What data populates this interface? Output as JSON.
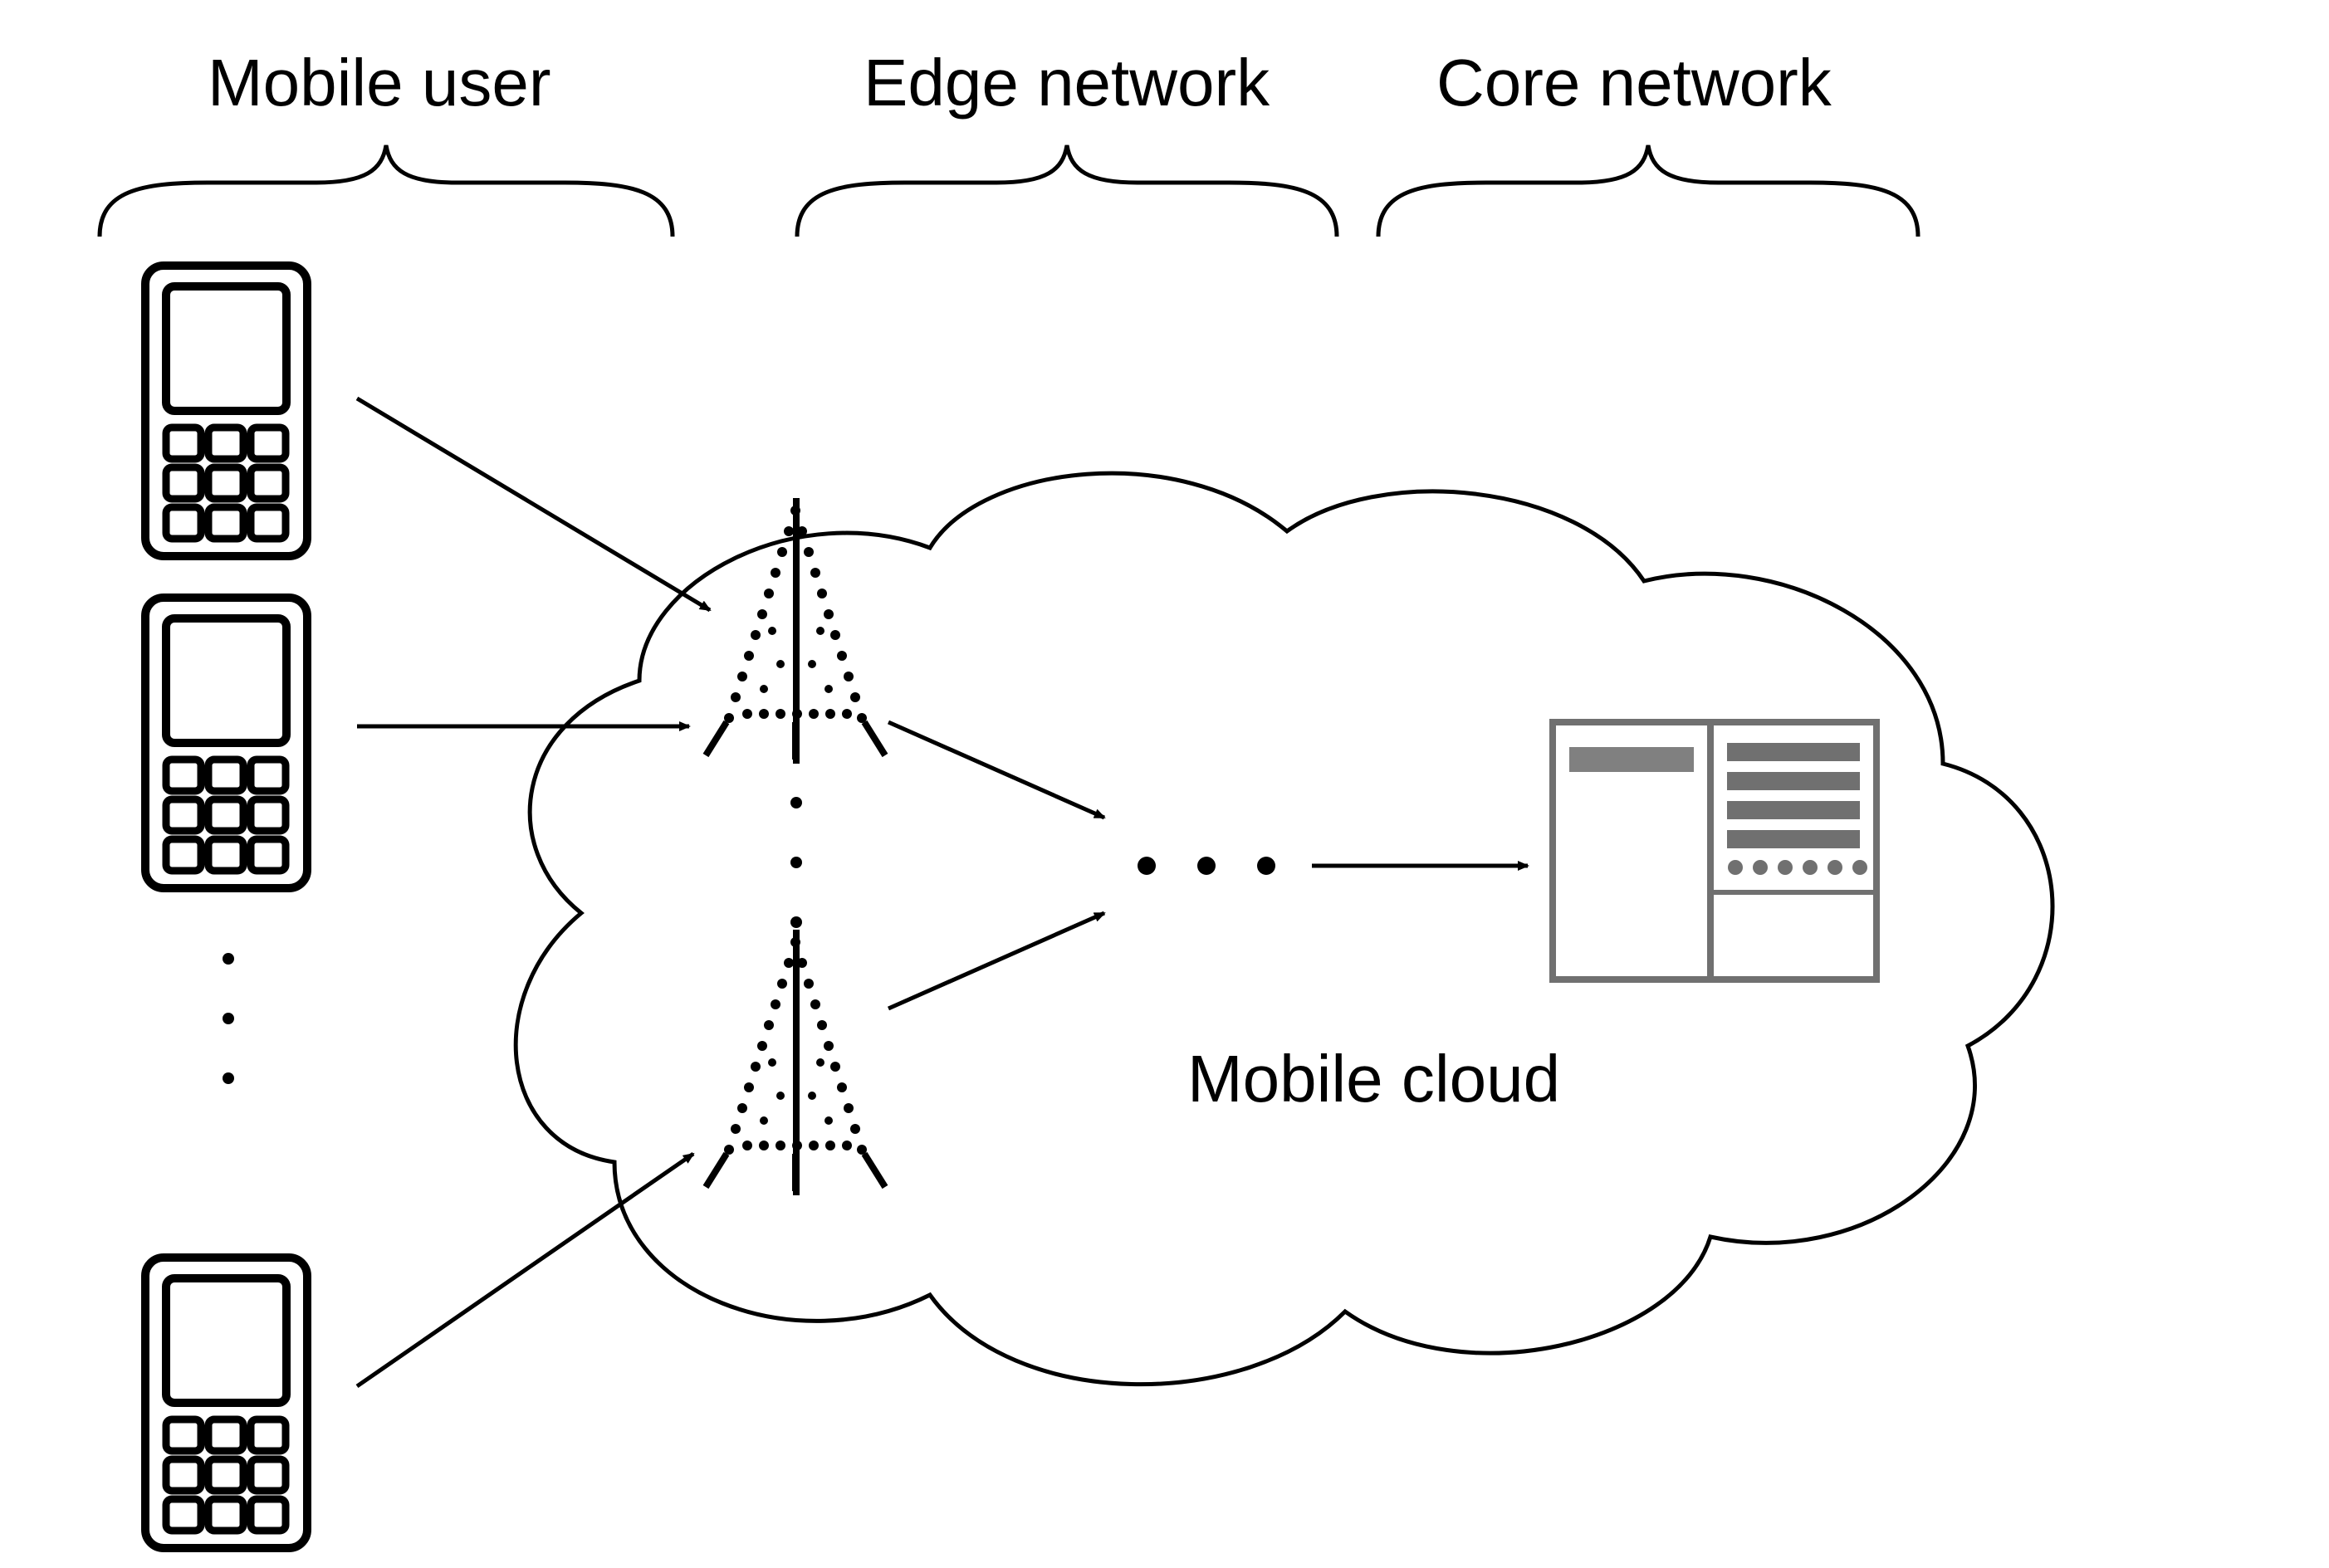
{
  "labels": {
    "mobile_user": "Mobile user",
    "edge_network": "Edge network",
    "core_network": "Core network",
    "mobile_cloud": "Mobile cloud"
  },
  "entities": {
    "mobile_phone": "mobile-phone",
    "cell_tower": "cell-tower",
    "server": "server",
    "cloud": "cloud"
  },
  "arrows": [
    {
      "from": "phone-1",
      "to": "tower-1"
    },
    {
      "from": "phone-2",
      "to": "tower-1"
    },
    {
      "from": "phone-3",
      "to": "tower-2"
    },
    {
      "from": "tower-1",
      "to": "mid-hops"
    },
    {
      "from": "tower-2",
      "to": "mid-hops"
    },
    {
      "from": "mid-hops",
      "to": "server"
    }
  ]
}
